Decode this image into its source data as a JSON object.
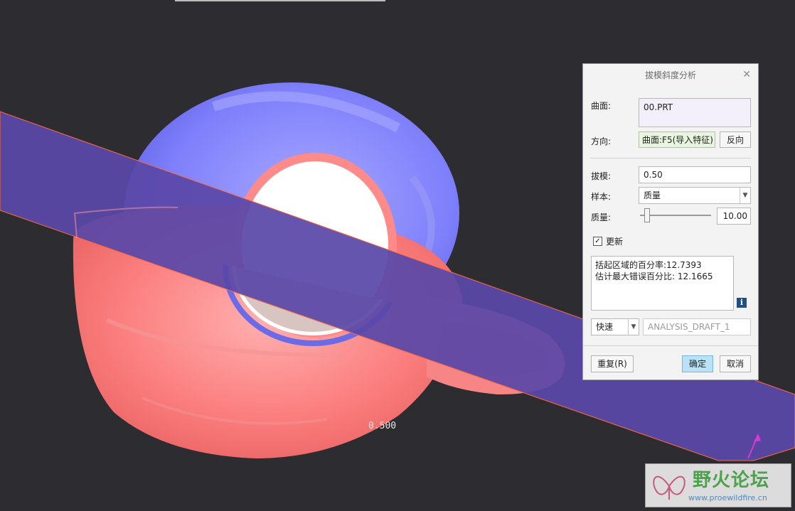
{
  "viewport": {
    "dimension_label": "0.500",
    "colors": {
      "background": "#2d2c31",
      "positive_draft": "#8080ff",
      "negative_draft": "#ff7070",
      "plane": "#5a48a8"
    }
  },
  "dialog": {
    "title": "拔模斜度分析",
    "close_icon": "close-icon",
    "surface_label": "曲面:",
    "surface_value": "00.PRT",
    "direction_label": "方向:",
    "direction_value": "曲面:F5(导入特征)",
    "reverse_button": "反向",
    "draft_label": "拔模:",
    "draft_value": "0.50",
    "sample_label": "样本:",
    "sample_value": "质量",
    "quality_label": "质量:",
    "quality_value": "10.00",
    "quality_slider_fraction": 0.1,
    "update_checked": true,
    "update_label": "更新",
    "result_line1": "括起区域的百分率:12.7393",
    "result_line2": "估计最大错误百分比: 12.1665",
    "mode_value": "快速",
    "analysis_name": "ANALYSIS_DRAFT_1",
    "repeat_button": "重复(R)",
    "ok_button": "确定",
    "cancel_button": "取消"
  },
  "watermark": {
    "title": "野火论坛",
    "url": "www.proewildfire.cn"
  }
}
